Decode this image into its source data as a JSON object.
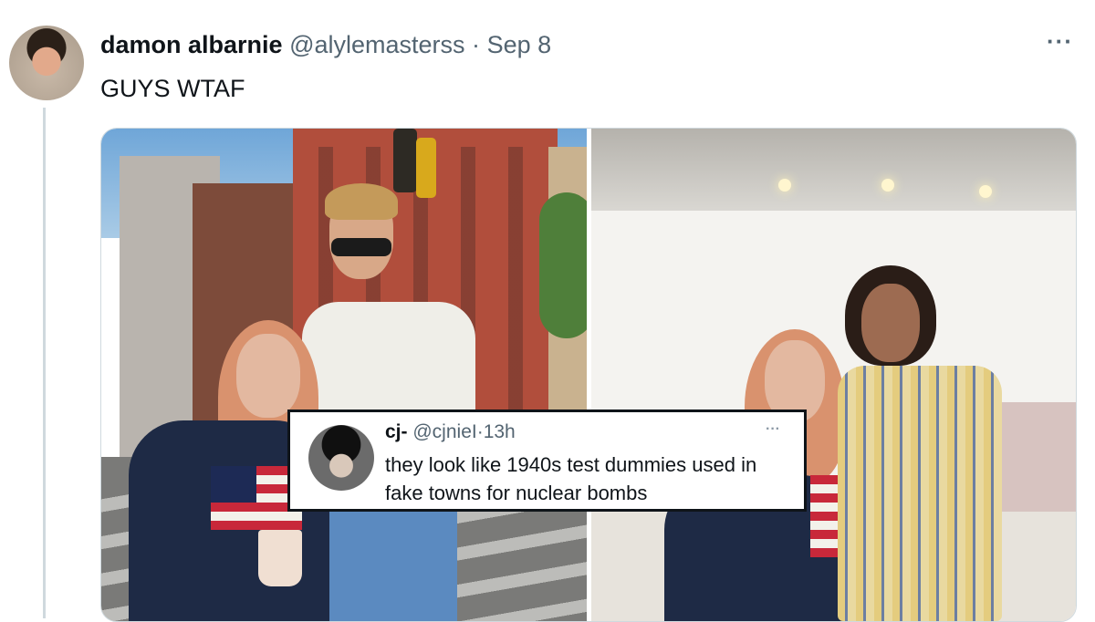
{
  "tweet": {
    "display_name": "damon albarnie",
    "handle": "@alylemasterss",
    "separator": "·",
    "date": "Sep 8",
    "text": "GUYS WTAF",
    "more_icon": "more-horizontal-icon",
    "more_glyph": "···"
  },
  "quote": {
    "display_name": "cj-",
    "handle": "@cjnieI",
    "separator": "·",
    "time": "13h",
    "more_glyph": "···",
    "text": "they look like 1940s test dummies used in fake towns for nuclear bombs"
  },
  "colors": {
    "text_primary": "#0f1419",
    "text_muted": "#536471",
    "border": "#cfd9de"
  }
}
